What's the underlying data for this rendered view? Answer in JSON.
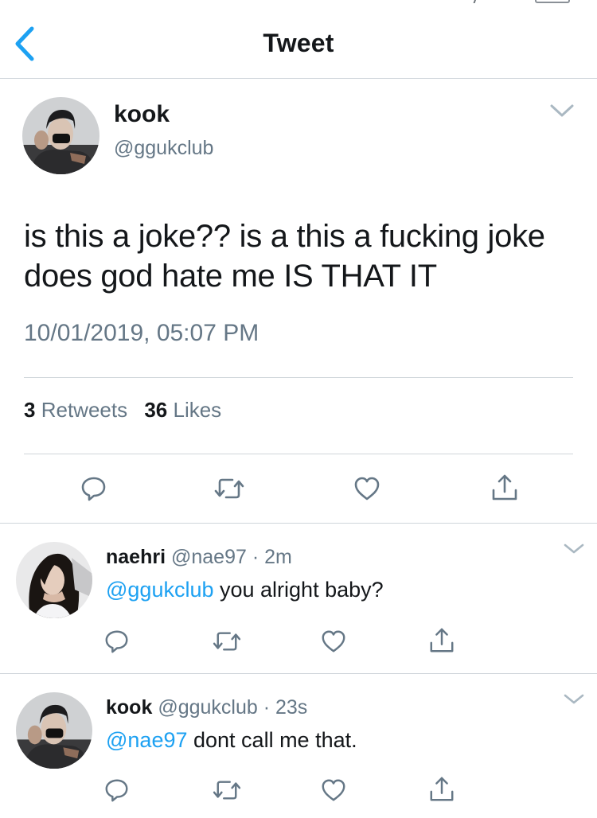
{
  "header": {
    "title": "Tweet",
    "back_icon": "chevron-left-icon"
  },
  "main_tweet": {
    "name": "kook",
    "handle": "@ggukclub",
    "text": "is this a joke?? is a this a fucking joke does god hate me IS THAT IT",
    "timestamp": "10/01/2019, 05:07 PM",
    "retweets_count": "3",
    "retweets_label": "Retweets",
    "likes_count": "36",
    "likes_label": "Likes",
    "actions": [
      "reply-icon",
      "retweet-icon",
      "like-icon",
      "share-icon"
    ]
  },
  "replies": [
    {
      "name": "naehri",
      "handle": "@nae97",
      "separator": "·",
      "time": "2m",
      "mention": "@ggukclub",
      "text": " you alright baby?"
    },
    {
      "name": "kook",
      "handle": "@ggukclub",
      "separator": "·",
      "time": "23s",
      "mention": "@nae97",
      "text": " dont call me that."
    }
  ],
  "colors": {
    "link": "#1da1f2",
    "secondary_text": "#657786",
    "divider": "#cfd5da",
    "icon": "#657786"
  }
}
